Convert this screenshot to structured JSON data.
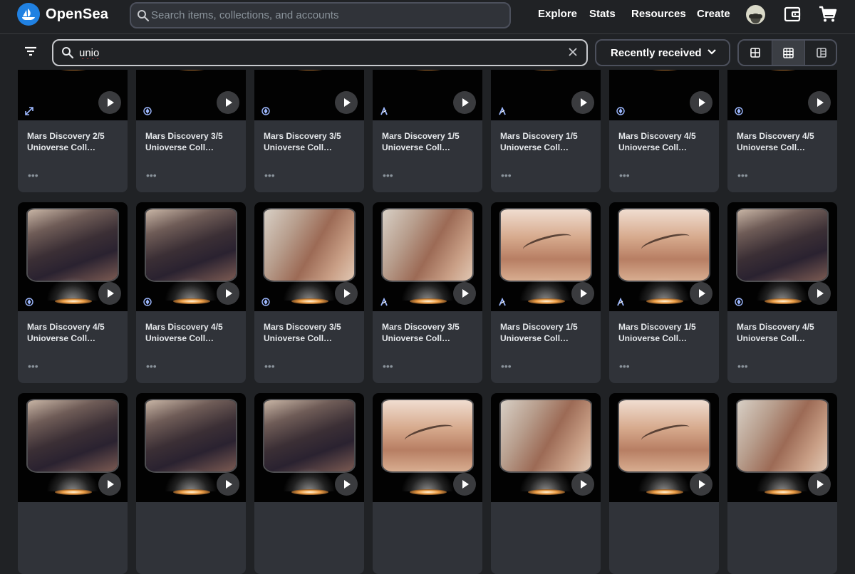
{
  "brand": {
    "name": "OpenSea",
    "logo_icon": "opensea-logo-icon"
  },
  "header": {
    "search_placeholder": "Search items, collections, and accounts",
    "nav": [
      "Explore",
      "Stats",
      "Resources",
      "Create"
    ],
    "icons": [
      "avatar",
      "wallet-icon",
      "cart-icon"
    ]
  },
  "filterbar": {
    "filter_icon": "filter-icon",
    "search_value": "unio",
    "clear_icon": "close-icon",
    "sort_label": "Recently received",
    "sort_icon": "chevron-down-icon",
    "view_modes": [
      "large-grid-icon",
      "small-grid-icon",
      "list-view-icon"
    ],
    "selected_view": "small-grid-icon"
  },
  "more_label": "•••",
  "cards": [
    {
      "title": "Mars Discovery 2/5",
      "collection": "Unioverse Collection",
      "chain": "polygon",
      "art": "top"
    },
    {
      "title": "Mars Discovery 3/5",
      "collection": "Unioverse Collection",
      "chain": "eth",
      "art": "top"
    },
    {
      "title": "Mars Discovery 3/5",
      "collection": "Unioverse Collection",
      "chain": "eth",
      "art": "top"
    },
    {
      "title": "Mars Discovery 1/5",
      "collection": "Unioverse Collection",
      "chain": "arb",
      "art": "top"
    },
    {
      "title": "Mars Discovery 1/5",
      "collection": "Unioverse Collection",
      "chain": "arb",
      "art": "top"
    },
    {
      "title": "Mars Discovery 4/5",
      "collection": "Unioverse Collection",
      "chain": "eth",
      "art": "top"
    },
    {
      "title": "Mars Discovery 4/5",
      "collection": "Unioverse Collection",
      "chain": "eth",
      "art": "top"
    },
    {
      "title": "Mars Discovery 4/5",
      "collection": "Unioverse Collection",
      "chain": "eth",
      "art": "cave"
    },
    {
      "title": "Mars Discovery 4/5",
      "collection": "Unioverse Collection",
      "chain": "eth",
      "art": "cave"
    },
    {
      "title": "Mars Discovery 3/5",
      "collection": "Unioverse Collection",
      "chain": "eth",
      "art": "dust"
    },
    {
      "title": "Mars Discovery 3/5",
      "collection": "Unioverse Collection",
      "chain": "arb",
      "art": "dust"
    },
    {
      "title": "Mars Discovery 1/5",
      "collection": "Unioverse Collection",
      "chain": "arb",
      "art": "creature"
    },
    {
      "title": "Mars Discovery 1/5",
      "collection": "Unioverse Collection",
      "chain": "arb",
      "art": "creature"
    },
    {
      "title": "Mars Discovery 4/5",
      "collection": "Unioverse Collection",
      "chain": "eth",
      "art": "cave"
    },
    {
      "title": "",
      "collection": "",
      "chain": "",
      "art": "cave"
    },
    {
      "title": "",
      "collection": "",
      "chain": "",
      "art": "cave"
    },
    {
      "title": "",
      "collection": "",
      "chain": "",
      "art": "cave"
    },
    {
      "title": "",
      "collection": "",
      "chain": "",
      "art": "creature"
    },
    {
      "title": "",
      "collection": "",
      "chain": "",
      "art": "dust"
    },
    {
      "title": "",
      "collection": "",
      "chain": "",
      "art": "creature"
    },
    {
      "title": "",
      "collection": "",
      "chain": "",
      "art": "dust"
    }
  ]
}
